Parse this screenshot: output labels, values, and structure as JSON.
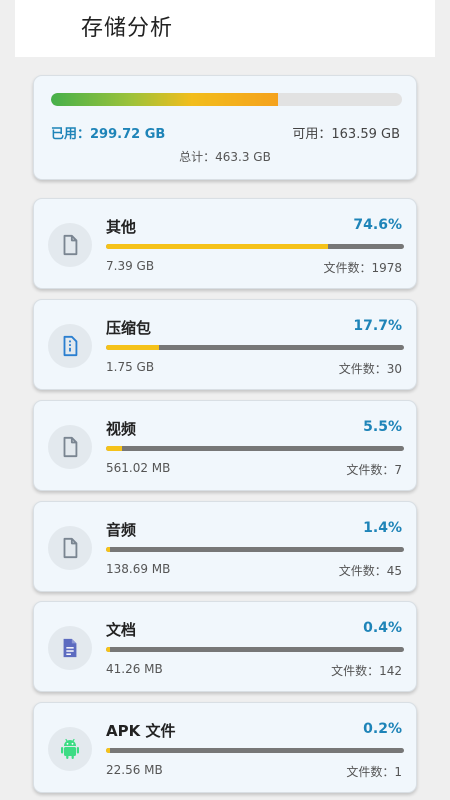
{
  "header": {
    "title": "存储分析"
  },
  "summary": {
    "used_text": "已用：299.72 GB",
    "available_text": "可用：163.59 GB",
    "total_text": "总计：463.3 GB",
    "used_fraction": 0.647
  },
  "categories": [
    {
      "name": "其他",
      "percent_text": "74.6%",
      "fraction": 0.746,
      "size": "7.39 GB",
      "count_text": "文件数：1978",
      "icon": "file-icon",
      "icon_color": "#7a8591"
    },
    {
      "name": "压缩包",
      "percent_text": "17.7%",
      "fraction": 0.177,
      "size": "1.75 GB",
      "count_text": "文件数：30",
      "icon": "archive-icon",
      "icon_color": "#2b7fd0"
    },
    {
      "name": "视频",
      "percent_text": "5.5%",
      "fraction": 0.055,
      "size": "561.02 MB",
      "count_text": "文件数：7",
      "icon": "file-icon",
      "icon_color": "#7a8591"
    },
    {
      "name": "音频",
      "percent_text": "1.4%",
      "fraction": 0.014,
      "size": "138.69 MB",
      "count_text": "文件数：45",
      "icon": "file-icon",
      "icon_color": "#7a8591"
    },
    {
      "name": "文档",
      "percent_text": "0.4%",
      "fraction": 0.004,
      "size": "41.26 MB",
      "count_text": "文件数：142",
      "icon": "document-icon",
      "icon_color": "#5c6bc0"
    },
    {
      "name": "APK 文件",
      "percent_text": "0.2%",
      "fraction": 0.002,
      "size": "22.56 MB",
      "count_text": "文件数：1",
      "icon": "android-icon",
      "icon_color": "#3ddc84"
    }
  ],
  "colors": {
    "accent": "#1e84b8",
    "progress_fill": "#f5c21a",
    "progress_track": "#777777"
  }
}
